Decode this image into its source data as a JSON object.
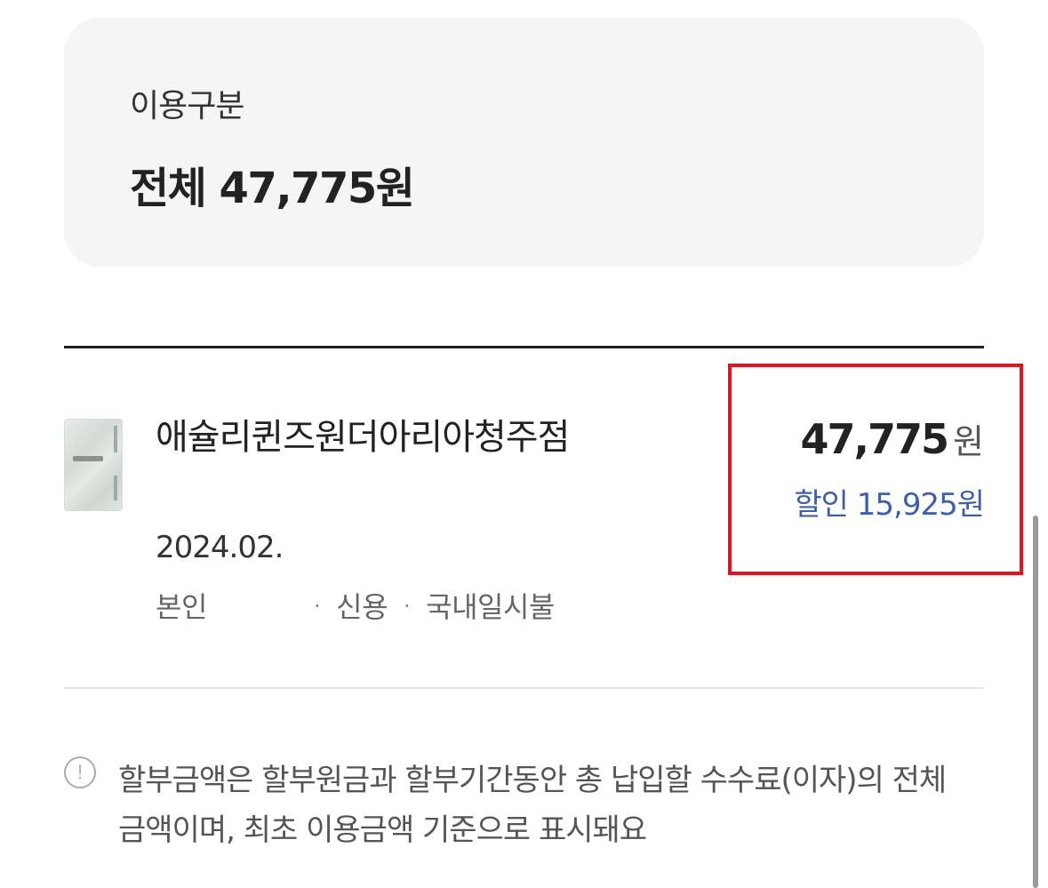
{
  "summary": {
    "label": "이용구분",
    "total": "전체 47,775원"
  },
  "transaction": {
    "merchant": "애슐리퀸즈원더아리아청주점",
    "date": "2024.02.",
    "user": "본인",
    "payment_type": "신용",
    "installment": "국내일시불",
    "separator": "·",
    "amount": "47,775",
    "currency": "원",
    "discount": "할인 15,925원",
    "card_icon": "card-thumbnail"
  },
  "notice": {
    "icon": "exclamation-circle-icon",
    "icon_glyph": "!",
    "text": "할부금액은 할부원금과 할부기간동안 총 납입할 수수료(이자)의 전체금액이며, 최초 이용금액 기준으로 표시돼요"
  },
  "colors": {
    "highlight": "#e3141f",
    "discount": "#3f5fa8",
    "card_bg": "#f5f5f5"
  }
}
